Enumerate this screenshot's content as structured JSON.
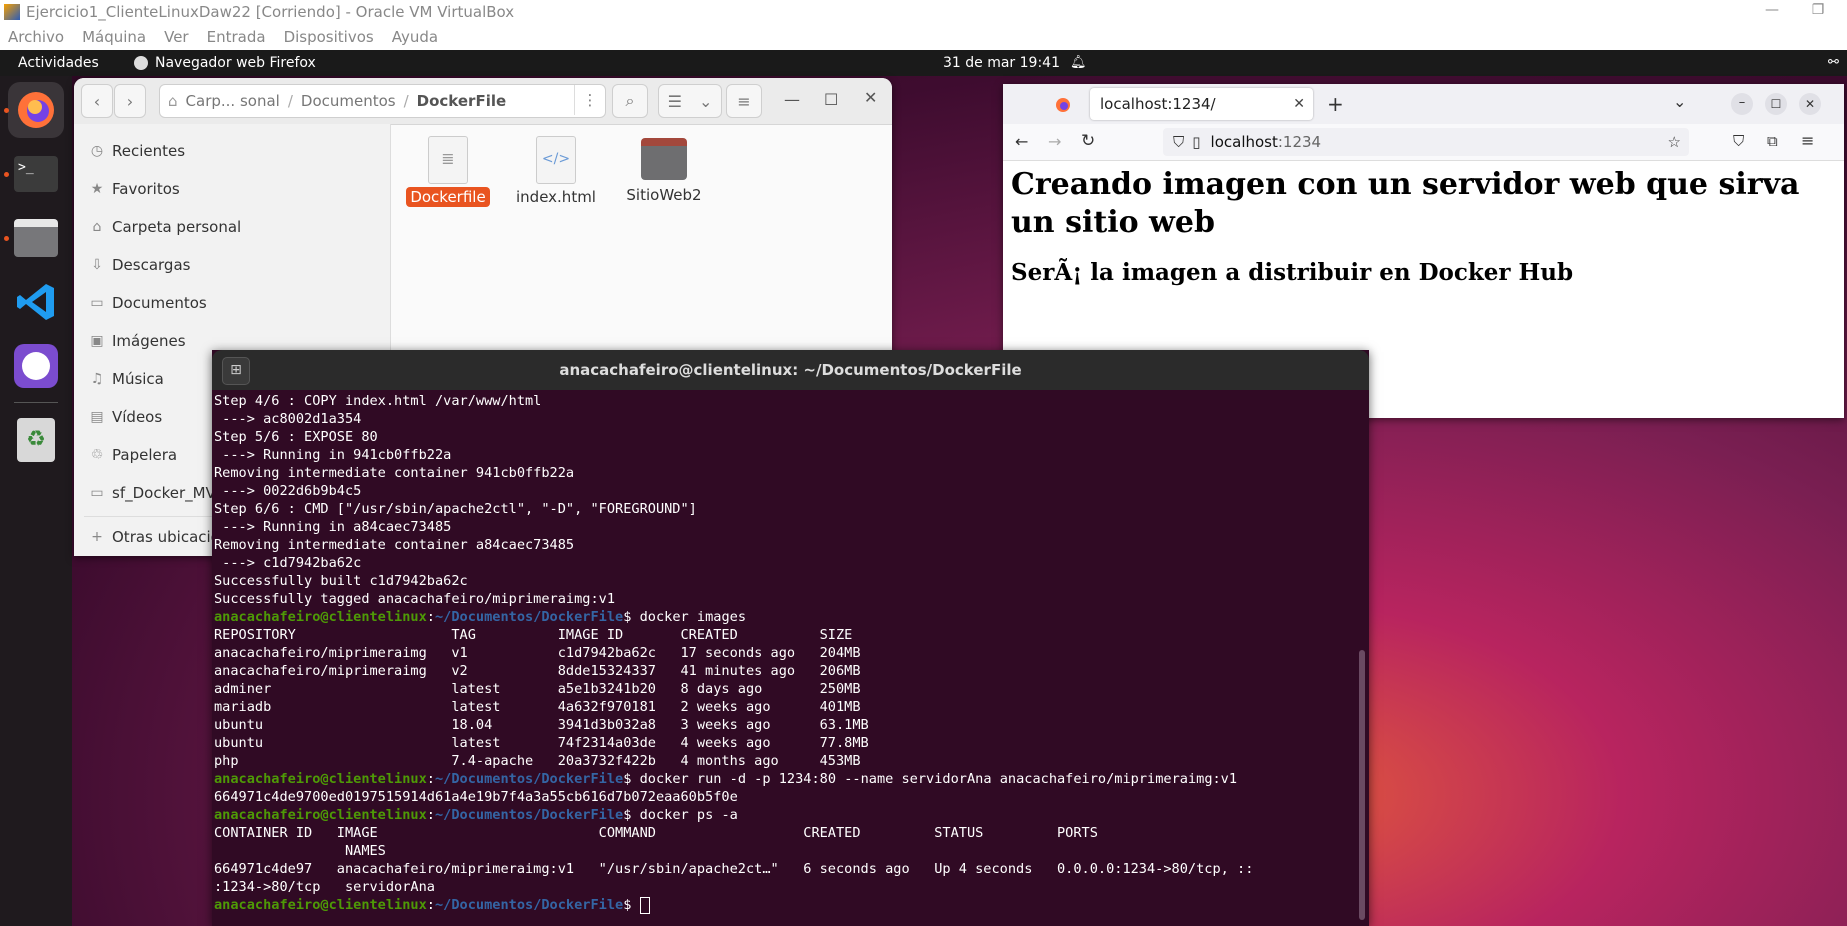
{
  "vbox": {
    "title": "Ejercicio1_ClienteLinuxDaw22 [Corriendo] - Oracle VM VirtualBox",
    "menu": [
      "Archivo",
      "Máquina",
      "Ver",
      "Entrada",
      "Dispositivos",
      "Ayuda"
    ]
  },
  "topbar": {
    "activities": "Actividades",
    "app": "Navegador web Firefox",
    "clock": "31 de mar  19:41"
  },
  "dock": {
    "items": [
      "firefox-icon",
      "terminal-icon",
      "files-icon",
      "vscode-icon",
      "github-desktop-icon",
      "trash-icon"
    ]
  },
  "files": {
    "path": {
      "p1": "Carp... sonal",
      "p2": "Documentos",
      "p3": "DockerFile"
    },
    "sidebar": [
      {
        "icon": "clock-icon",
        "glyph": "◷",
        "label": "Recientes"
      },
      {
        "icon": "star-icon",
        "glyph": "★",
        "label": "Favoritos"
      },
      {
        "icon": "home-icon",
        "glyph": "⌂",
        "label": "Carpeta personal"
      },
      {
        "icon": "download-icon",
        "glyph": "⇩",
        "label": "Descargas"
      },
      {
        "icon": "document-icon",
        "glyph": "▭",
        "label": "Documentos"
      },
      {
        "icon": "image-icon",
        "glyph": "▣",
        "label": "Imágenes"
      },
      {
        "icon": "music-icon",
        "glyph": "♫",
        "label": "Música"
      },
      {
        "icon": "video-icon",
        "glyph": "▤",
        "label": "Vídeos"
      },
      {
        "icon": "trash-icon",
        "glyph": "♲",
        "label": "Papelera"
      },
      {
        "icon": "drive-icon",
        "glyph": "▭",
        "label": "sf_Docker_MV"
      },
      {
        "icon": "plus-icon",
        "glyph": "+",
        "label": "Otras ubicaciones"
      }
    ],
    "items": [
      {
        "name": "Dockerfile",
        "kind": "text-file-icon"
      },
      {
        "name": "index.html",
        "kind": "html-file-icon"
      },
      {
        "name": "SitioWeb2",
        "kind": "folder-icon"
      }
    ]
  },
  "firefox": {
    "tab_title": "localhost:1234/",
    "url_host": "localhost",
    "url_port": ":1234",
    "heading": "Creando imagen con un servidor web que sirva un sitio web",
    "subheading": "SerÃ¡ la imagen a distribuir en Docker Hub"
  },
  "terminal": {
    "title": "anacachafeiro@clientelinux: ~/Documentos/DockerFile",
    "user": "anacachafeiro@clientelinux",
    "path": "~/Documentos/DockerFile",
    "lines": [
      {
        "t": "o",
        "s": "Step 4/6 : COPY index.html /var/www/html"
      },
      {
        "t": "o",
        "s": " ---> ac8002d1a354"
      },
      {
        "t": "o",
        "s": "Step 5/6 : EXPOSE 80"
      },
      {
        "t": "o",
        "s": " ---> Running in 941cb0ffb22a"
      },
      {
        "t": "o",
        "s": "Removing intermediate container 941cb0ffb22a"
      },
      {
        "t": "o",
        "s": " ---> 0022d6b9b4c5"
      },
      {
        "t": "o",
        "s": "Step 6/6 : CMD [\"/usr/sbin/apache2ctl\", \"-D\", \"FOREGROUND\"]"
      },
      {
        "t": "o",
        "s": " ---> Running in a84caec73485"
      },
      {
        "t": "o",
        "s": "Removing intermediate container a84caec73485"
      },
      {
        "t": "o",
        "s": " ---> c1d7942ba62c"
      },
      {
        "t": "o",
        "s": "Successfully built c1d7942ba62c"
      },
      {
        "t": "o",
        "s": "Successfully tagged anacachafeiro/miprimeraimg:v1"
      },
      {
        "t": "p",
        "s": "docker images"
      },
      {
        "t": "o",
        "s": "REPOSITORY                   TAG          IMAGE ID       CREATED          SIZE"
      },
      {
        "t": "o",
        "s": "anacachafeiro/miprimeraimg   v1           c1d7942ba62c   17 seconds ago   204MB"
      },
      {
        "t": "o",
        "s": "anacachafeiro/miprimeraimg   v2           8dde15324337   41 minutes ago   206MB"
      },
      {
        "t": "o",
        "s": "adminer                      latest       a5e1b3241b20   8 days ago       250MB"
      },
      {
        "t": "o",
        "s": "mariadb                      latest       4a632f970181   2 weeks ago      401MB"
      },
      {
        "t": "o",
        "s": "ubuntu                       18.04        3941d3b032a8   3 weeks ago      63.1MB"
      },
      {
        "t": "o",
        "s": "ubuntu                       latest       74f2314a03de   4 weeks ago      77.8MB"
      },
      {
        "t": "o",
        "s": "php                          7.4-apache   20a3732f422b   4 months ago     453MB"
      },
      {
        "t": "p",
        "s": "docker run -d -p 1234:80 --name servidorAna anacachafeiro/miprimeraimg:v1"
      },
      {
        "t": "o",
        "s": "664971c4de9700ed0197515914d61a4e19b7f4a3a55cb616d7b072eaa60b5f0e"
      },
      {
        "t": "p",
        "s": "docker ps -a"
      },
      {
        "t": "o",
        "s": "CONTAINER ID   IMAGE                           COMMAND                  CREATED         STATUS         PORTS"
      },
      {
        "t": "o",
        "s": "                NAMES"
      },
      {
        "t": "o",
        "s": "664971c4de97   anacachafeiro/miprimeraimg:v1   \"/usr/sbin/apache2ct…\"   6 seconds ago   Up 4 seconds   0.0.0.0:1234->80/tcp, ::"
      },
      {
        "t": "o",
        "s": ":1234->80/tcp   servidorAna"
      },
      {
        "t": "c",
        "s": ""
      }
    ]
  }
}
